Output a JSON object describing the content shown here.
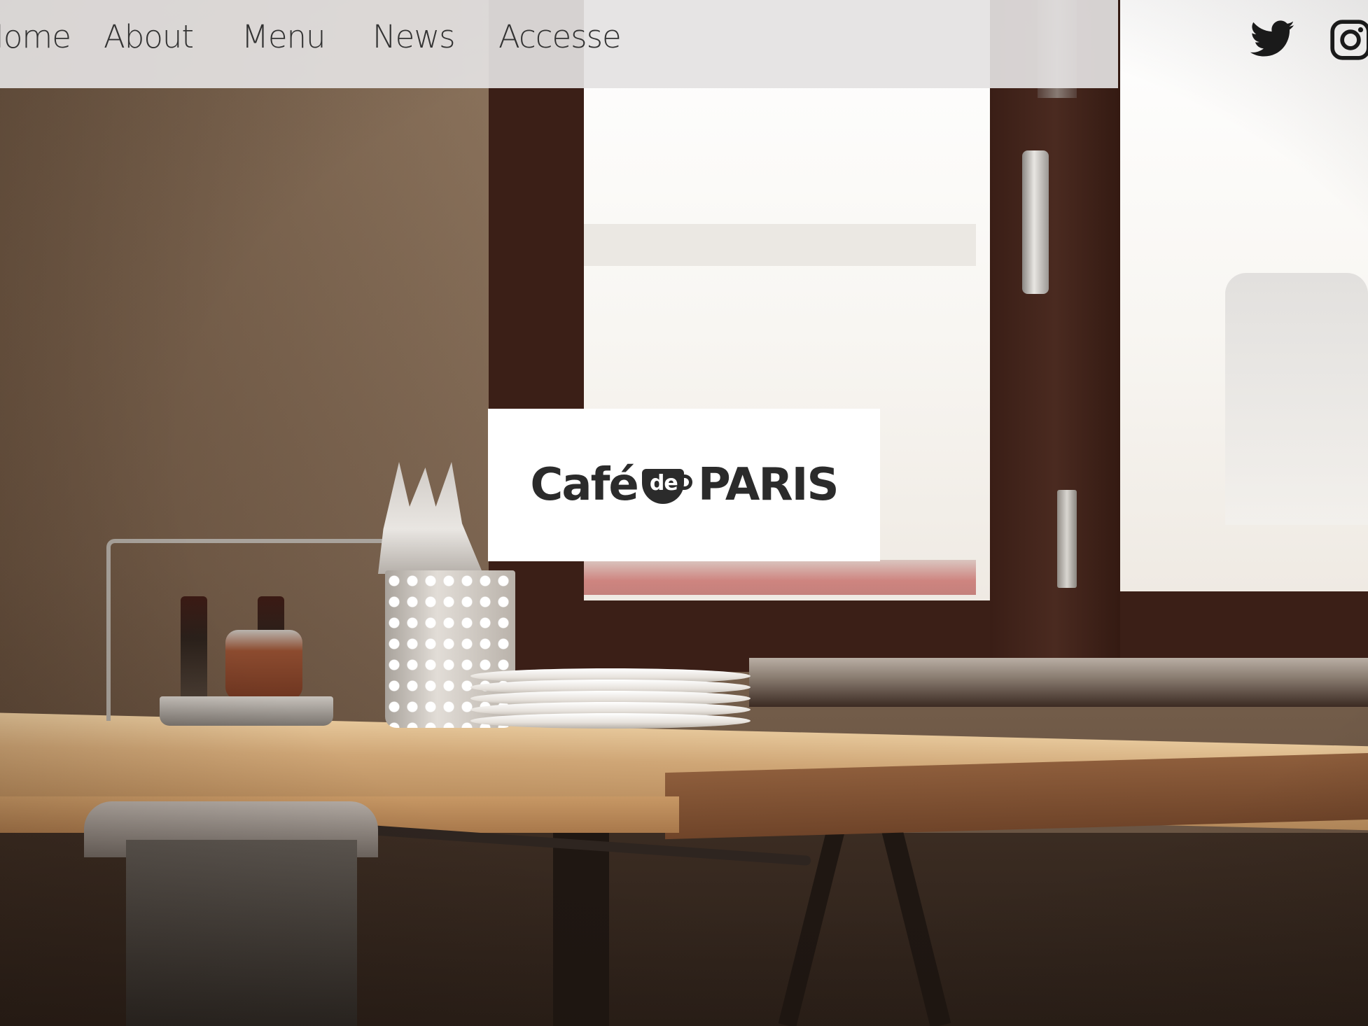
{
  "nav": {
    "items": [
      {
        "label": "Home"
      },
      {
        "label": "About"
      },
      {
        "label": "Menu"
      },
      {
        "label": "News"
      },
      {
        "label": "Accesse"
      }
    ]
  },
  "social": {
    "twitter_icon": "twitter-icon",
    "instagram_icon": "instagram-icon"
  },
  "logo": {
    "cafe": "Café",
    "de": "de",
    "paris": "PARIS"
  },
  "colors": {
    "nav_bar": "#e4e2e2",
    "nav_text": "#333333",
    "logo_text": "#2b2b2b",
    "logo_card": "#ffffff"
  }
}
